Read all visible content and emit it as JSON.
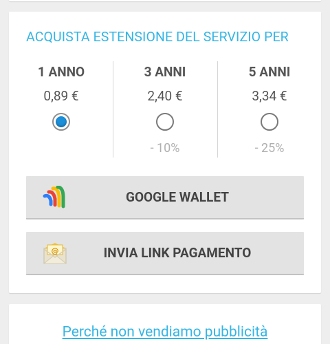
{
  "purchase": {
    "heading": "ACQUISTA ESTENSIONE DEL SERVIZIO PER",
    "plans": [
      {
        "title": "1 ANNO",
        "price": "0,89 €",
        "discount": "",
        "selected": true
      },
      {
        "title": "3 ANNI",
        "price": "2,40 €",
        "discount": "- 10%",
        "selected": false
      },
      {
        "title": "5 ANNI",
        "price": "3,34 €",
        "discount": "- 25%",
        "selected": false
      }
    ],
    "buttons": {
      "google_wallet": "GOOGLE WALLET",
      "send_payment_link": "INVIA LINK PAGAMENTO"
    }
  },
  "info": {
    "why_no_ads_link": "Perché non vendiamo pubblicità"
  },
  "colors": {
    "accent": "#33b5e5",
    "radio_selected": "#1c8fd9",
    "card_bg": "#ffffff",
    "page_bg": "#eeeeee",
    "button_bg": "#e3e3e3"
  },
  "icons": {
    "wallet": "google-wallet-icon",
    "email": "email-envelope-icon"
  }
}
